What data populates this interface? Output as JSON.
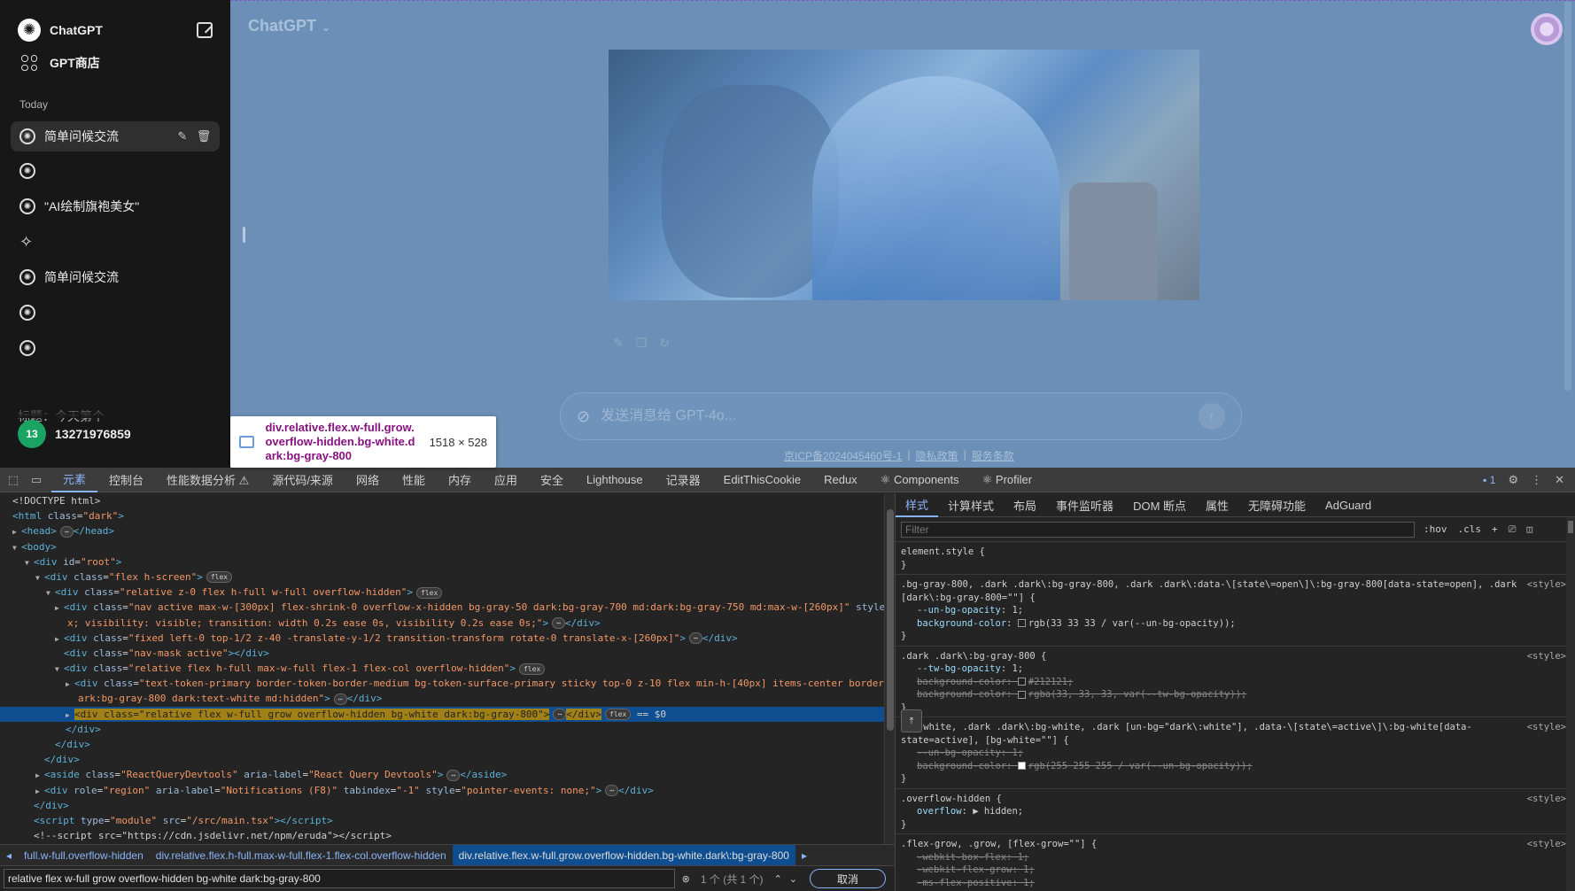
{
  "sidebar": {
    "title": "ChatGPT",
    "gpt_store": "GPT商店",
    "section_today": "Today",
    "items": [
      {
        "label": "简单问候交流"
      },
      {
        "label": ""
      },
      {
        "label": "\"AI绘制旗袍美女\""
      },
      {
        "label": ""
      },
      {
        "label": "简单问候交流"
      },
      {
        "label": ""
      },
      {
        "label": ""
      },
      {
        "label": "标题：今天第个"
      }
    ],
    "user": {
      "avatar_text": "13",
      "name": "13271976859"
    }
  },
  "main": {
    "title": "ChatGPT",
    "input_placeholder": "发送消息给 GPT-4o...",
    "footer": {
      "icp": "京ICP备2024045460号-1",
      "sep": "|",
      "privacy": "隐私政策",
      "terms": "服务条款"
    }
  },
  "tooltip": {
    "selector": "div.relative.flex.w-full.grow.overflow-hidden.bg-white.dark:bg-gray-800",
    "size": "1518 × 528"
  },
  "devtools": {
    "tabs": [
      "元素",
      "控制台",
      "性能数据分析 ⚠",
      "源代码/来源",
      "网络",
      "性能",
      "内存",
      "应用",
      "安全",
      "Lighthouse",
      "记录器",
      "EditThisCookie",
      "Redux",
      "⚛ Components",
      "⚛ Profiler"
    ],
    "issues_badge": "1",
    "breadcrumbs": [
      "full.w-full.overflow-hidden",
      "div.relative.flex.h-full.max-w-full.flex-1.flex-col.overflow-hidden",
      "div.relative.flex.w-full.grow.overflow-hidden.bg-white.dark\\:bg-gray-800"
    ],
    "search": {
      "value": "relative flex w-full grow overflow-hidden bg-white dark:bg-gray-800",
      "count": "1 个 (共 1 个)",
      "cancel": "取消"
    },
    "styles_tabs": [
      "样式",
      "计算样式",
      "布局",
      "事件监听器",
      "DOM 断点",
      "属性",
      "无障碍功能",
      "AdGuard"
    ],
    "filter_placeholder": "Filter",
    "filter_tools": [
      ":hov",
      ".cls",
      "+"
    ]
  }
}
